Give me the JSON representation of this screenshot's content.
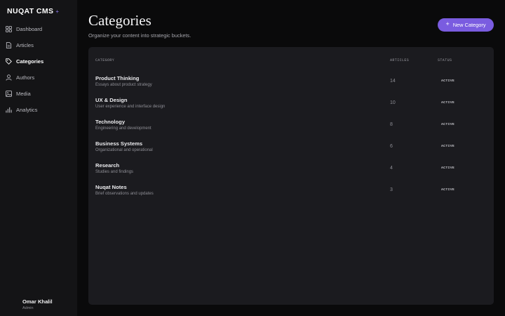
{
  "brand": {
    "name": "NUQAT CMS",
    "mark": "+"
  },
  "nav": [
    {
      "label": "Dashboard",
      "icon": "grid-icon",
      "active": false
    },
    {
      "label": "Articles",
      "icon": "document-icon",
      "active": false
    },
    {
      "label": "Categories",
      "icon": "tag-icon",
      "active": true
    },
    {
      "label": "Authors",
      "icon": "user-icon",
      "active": false
    },
    {
      "label": "Media",
      "icon": "image-icon",
      "active": false
    },
    {
      "label": "Analytics",
      "icon": "bar-chart-icon",
      "active": false
    }
  ],
  "user": {
    "name": "Omar Khalil",
    "role": "Admin"
  },
  "header": {
    "title": "Categories",
    "subtitle": "Organize your content into strategic buckets.",
    "new_button": "New Category",
    "new_button_icon": "sparkle-plus-icon"
  },
  "table": {
    "columns": {
      "category": "CATEGORY",
      "articles": "ARTICLES",
      "status": "STATUS"
    },
    "rows": [
      {
        "name": "Product Thinking",
        "desc": "Essays about product strategy",
        "articles": "14",
        "status": "ACTIVE"
      },
      {
        "name": "UX & Design",
        "desc": "User experience and interface design",
        "articles": "10",
        "status": "ACTIVE"
      },
      {
        "name": "Technology",
        "desc": "Engineering and development",
        "articles": "8",
        "status": "ACTIVE"
      },
      {
        "name": "Business Systems",
        "desc": "Organizational and operational",
        "articles": "6",
        "status": "ACTIVE"
      },
      {
        "name": "Research",
        "desc": "Studies and findings",
        "articles": "4",
        "status": "ACTIVE"
      },
      {
        "name": "Nuqat Notes",
        "desc": "Brief observations and updates",
        "articles": "3",
        "status": "ACTIVE"
      }
    ]
  },
  "colors": {
    "accent": "#7a5ce0",
    "sidebar": "#141416",
    "background": "#0a0a0b",
    "card": "#1b1b1f"
  }
}
